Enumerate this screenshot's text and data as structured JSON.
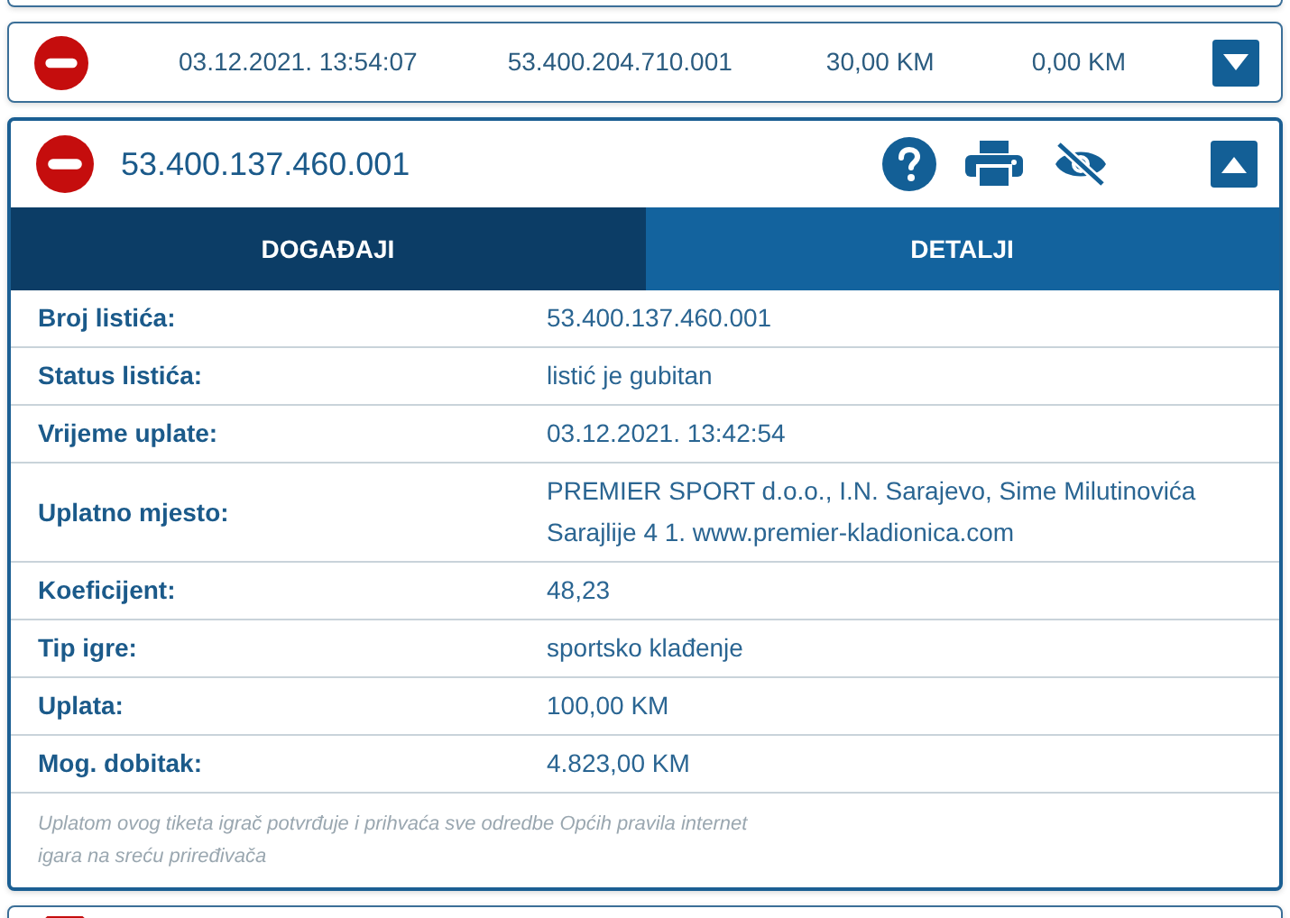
{
  "tickets": [
    {
      "kind": "tail"
    },
    {
      "kind": "collapsed",
      "lost": true,
      "expanded": false,
      "date": "03.12.2021. 13:54:07",
      "number": "53.400.204.710.001",
      "stake": "30,00 KM",
      "win": "0,00 KM"
    },
    {
      "kind": "open",
      "lost": true,
      "expanded": true,
      "number": "53.400.137.460.001",
      "tabs": [
        {
          "label": "DOGAĐAJI",
          "selected": false
        },
        {
          "label": "DETALJI",
          "selected": true
        }
      ],
      "details": [
        {
          "label": "Broj listića:",
          "value": "53.400.137.460.001"
        },
        {
          "label": "Status listića:",
          "value": "listić je gubitan"
        },
        {
          "label": "Vrijeme uplate:",
          "value": "03.12.2021. 13:42:54"
        },
        {
          "label": "Uplatno mjesto:",
          "value": "PREMIER SPORT d.o.o., I.N. Sarajevo, Sime Milutinovića Sarajlije 4 1. www.premier-kladionica.com"
        },
        {
          "label": "Koeficijent:",
          "value": "48,23"
        },
        {
          "label": "Tip igre:",
          "value": "sportsko klađenje"
        },
        {
          "label": "Uplata:",
          "value": "100,00 KM"
        },
        {
          "label": "Mog. dobitak:",
          "value": "4.823,00 KM"
        }
      ],
      "note": "Uplatom ovog tiketa igrač potvrđuje i prihvaća sve odredbe Općih pravila internet igara na sreću priređivača"
    },
    {
      "kind": "cut"
    }
  ]
}
